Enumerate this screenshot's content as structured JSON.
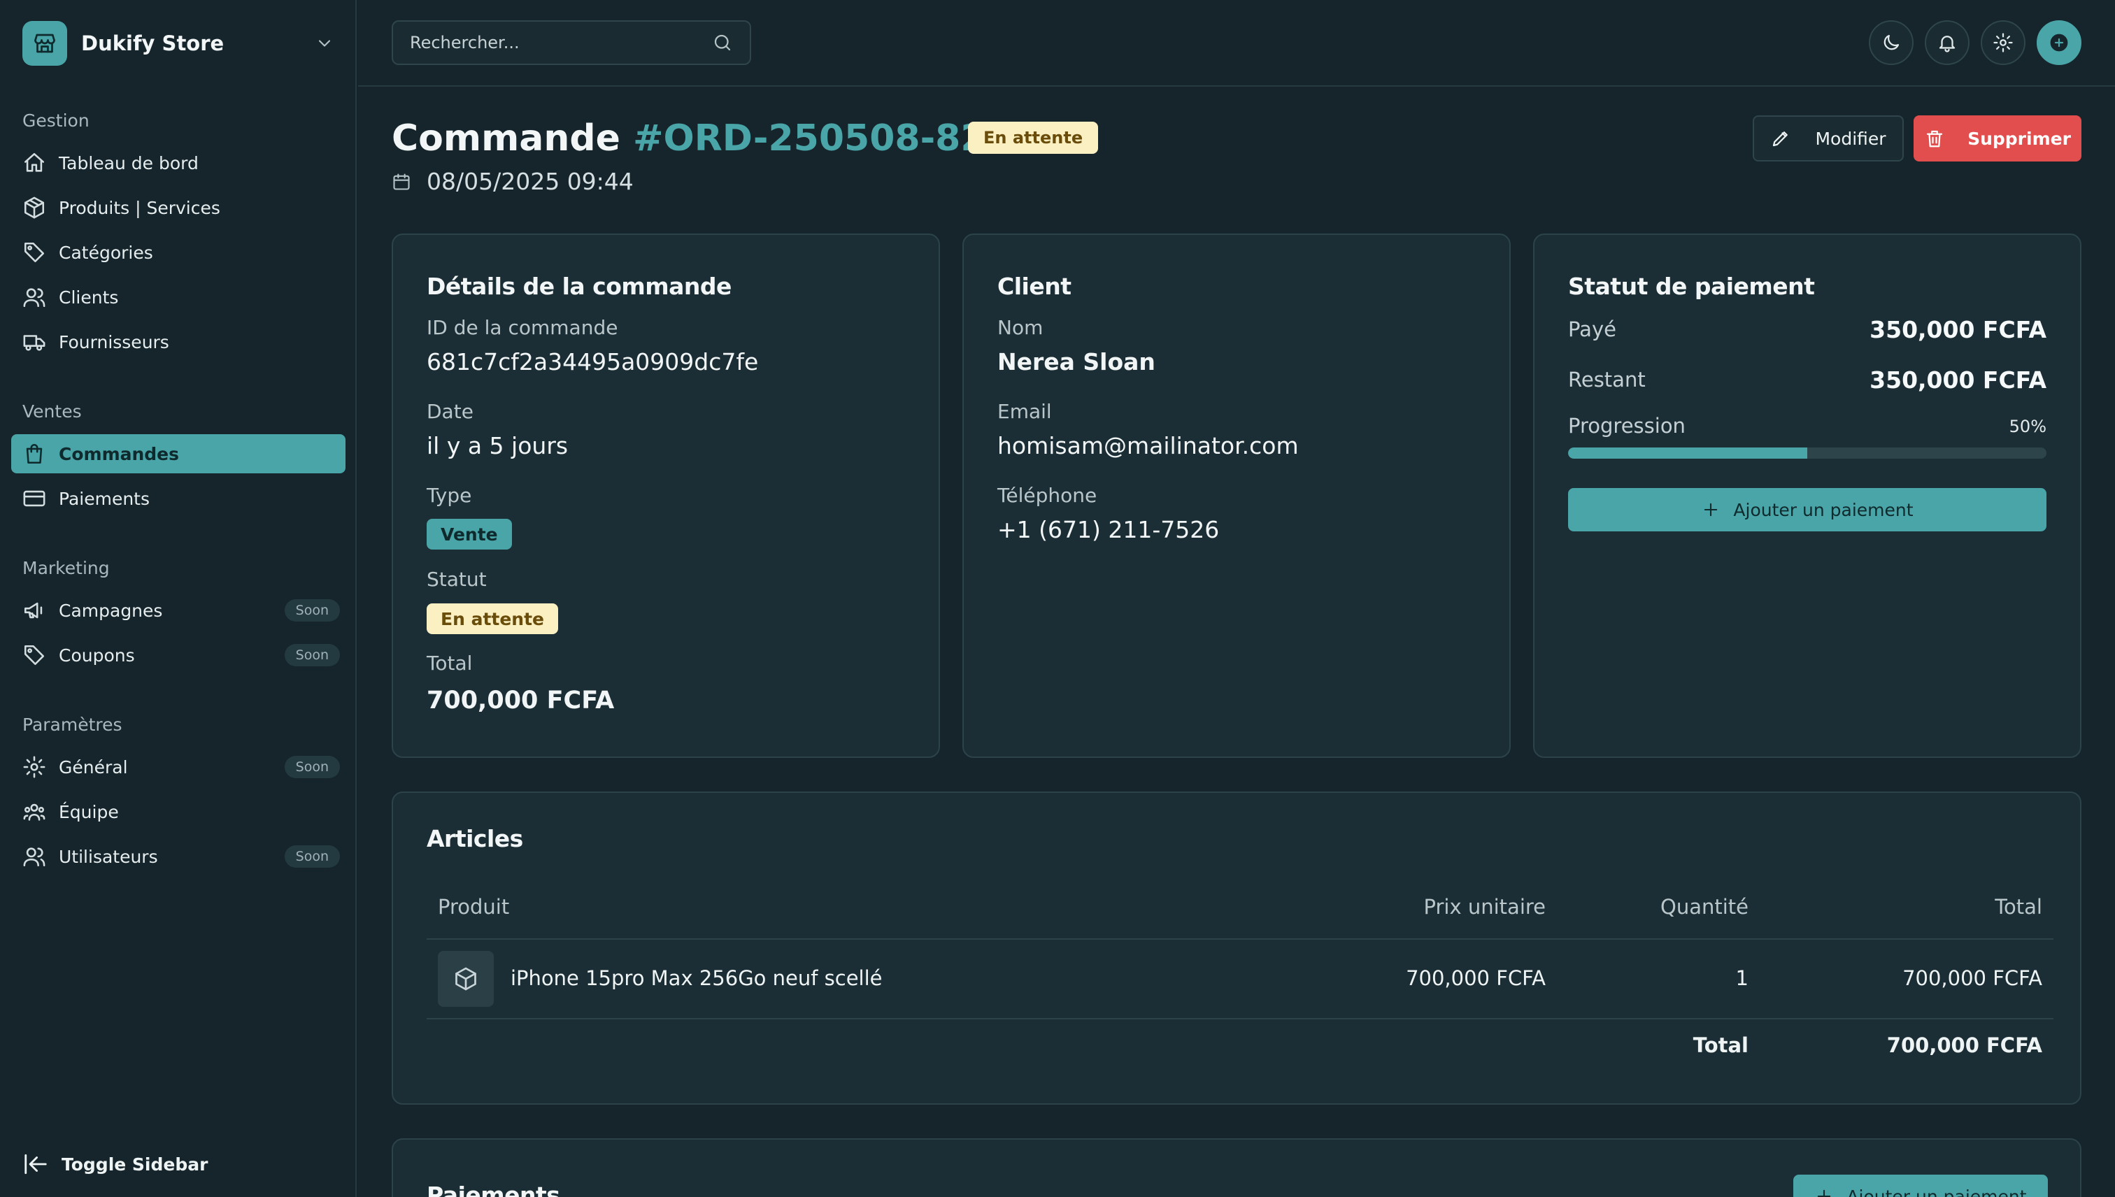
{
  "brand": {
    "name": "Dukify Store",
    "logo_icon": "store-icon"
  },
  "sidebar": {
    "groups": [
      {
        "label": "Gestion",
        "items": [
          {
            "label": "Tableau de bord",
            "icon": "home-icon"
          },
          {
            "label": "Produits | Services",
            "icon": "package-icon"
          },
          {
            "label": "Catégories",
            "icon": "tag-icon"
          },
          {
            "label": "Clients",
            "icon": "users-icon"
          },
          {
            "label": "Fournisseurs",
            "icon": "truck-icon"
          }
        ]
      },
      {
        "label": "Ventes",
        "items": [
          {
            "label": "Commandes",
            "icon": "shopping-bag-icon",
            "active": true
          },
          {
            "label": "Paiements",
            "icon": "credit-card-icon"
          }
        ]
      },
      {
        "label": "Marketing",
        "items": [
          {
            "label": "Campagnes",
            "icon": "megaphone-icon",
            "badge": "Soon"
          },
          {
            "label": "Coupons",
            "icon": "ticket-icon",
            "badge": "Soon"
          }
        ]
      },
      {
        "label": "Paramètres",
        "items": [
          {
            "label": "Général",
            "icon": "gear-icon",
            "badge": "Soon"
          },
          {
            "label": "Équipe",
            "icon": "team-icon"
          },
          {
            "label": "Utilisateurs",
            "icon": "user-group-icon",
            "badge": "Soon"
          }
        ]
      }
    ],
    "toggle_label": "Toggle Sidebar"
  },
  "topbar": {
    "search_placeholder": "Rechercher..."
  },
  "page": {
    "title_prefix": "Commande",
    "order_number": "#ORD-250508-8289",
    "status": "En attente",
    "datetime": "08/05/2025 09:44",
    "edit_label": "Modifier",
    "delete_label": "Supprimer"
  },
  "order_details": {
    "title": "Détails de la commande",
    "id_label": "ID de la commande",
    "id_value": "681c7cf2a34495a0909dc7fe",
    "date_label": "Date",
    "date_value": "il y a 5 jours",
    "type_label": "Type",
    "type_value": "Vente",
    "status_label": "Statut",
    "status_value": "En attente",
    "total_label": "Total",
    "total_value": "700,000 FCFA"
  },
  "client": {
    "title": "Client",
    "name_label": "Nom",
    "name_value": "Nerea Sloan",
    "email_label": "Email",
    "email_value": "homisam@mailinator.com",
    "phone_label": "Téléphone",
    "phone_value": "+1 (671) 211-7526"
  },
  "payment_status": {
    "title": "Statut de paiement",
    "paid_label": "Payé",
    "paid_value": "350,000 FCFA",
    "remaining_label": "Restant",
    "remaining_value": "350,000 FCFA",
    "progress_label": "Progression",
    "progress_text": "50%",
    "progress_percent": 50,
    "add_payment_label": "Ajouter un paiement"
  },
  "articles": {
    "title": "Articles",
    "columns": {
      "product": "Produit",
      "unit_price": "Prix unitaire",
      "quantity": "Quantité",
      "total": "Total"
    },
    "rows": [
      {
        "product": "iPhone 15pro Max 256Go neuf scellé",
        "unit_price": "700,000 FCFA",
        "quantity": "1",
        "total": "700,000 FCFA"
      }
    ],
    "total_label": "Total",
    "total_value": "700,000 FCFA"
  },
  "payments": {
    "title": "Paiements",
    "add_payment_label": "Ajouter un paiement"
  },
  "colors": {
    "accent": "#4aa5a8",
    "danger": "#e24d4d",
    "pending_bg": "#fbf0c2",
    "background": "#15252b",
    "card": "#1c2e35"
  }
}
